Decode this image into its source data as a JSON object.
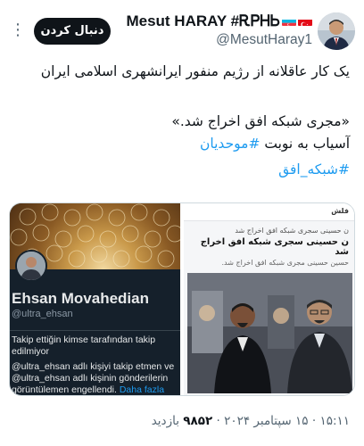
{
  "header": {
    "display_name": "Mesut HARAY #ᎡᏢᎻᏏ",
    "handle": "@MesutHaray1",
    "follow_label": "دنبال کردن",
    "more_label": "⋮"
  },
  "tweet": {
    "line1": "یک کار عاقلانه از رژیم منفور ایرانشهری اسلامی ایران",
    "line2": "«مجری شبکه افق اخراج شد.»",
    "line3_text": "آسیاب به نوبت ",
    "line3_hashtag": "#موحدیان",
    "line4_hashtag": "#شبکه_افق"
  },
  "media": {
    "profile_card": {
      "name": "Ehsan Movahedian",
      "handle": "@ultra_ehsan",
      "notice1": "Takip ettiğin kimse tarafından takip edilmiyor",
      "notice2_prefix": "@ultra_ehsan adlı kişiyi takip etmen ve @ultra_ehsan adlı kişinin gönderilerin görüntülemen engellendi. ",
      "notice2_link": "Daha fazla bilgi al"
    },
    "news_card": {
      "logo": "فلش",
      "headline_small": "ن حسینی سجری شبکه افق اخراج شد",
      "headline": "ن حسینی سجری شبکه افق اخراج شد",
      "sub": "حسین حسینی مجری شبکه افق اخراج شد."
    }
  },
  "footer": {
    "text": "۱۵:۱۱ · ۱۵ سپتامبر ۲۰۲۴ · ",
    "views": "۹۸۵۲",
    "views_label": " بازدید"
  },
  "colors": {
    "accent": "#1d9bf0",
    "text": "#0f1419",
    "muted": "#536471",
    "button": "#0f1419"
  }
}
